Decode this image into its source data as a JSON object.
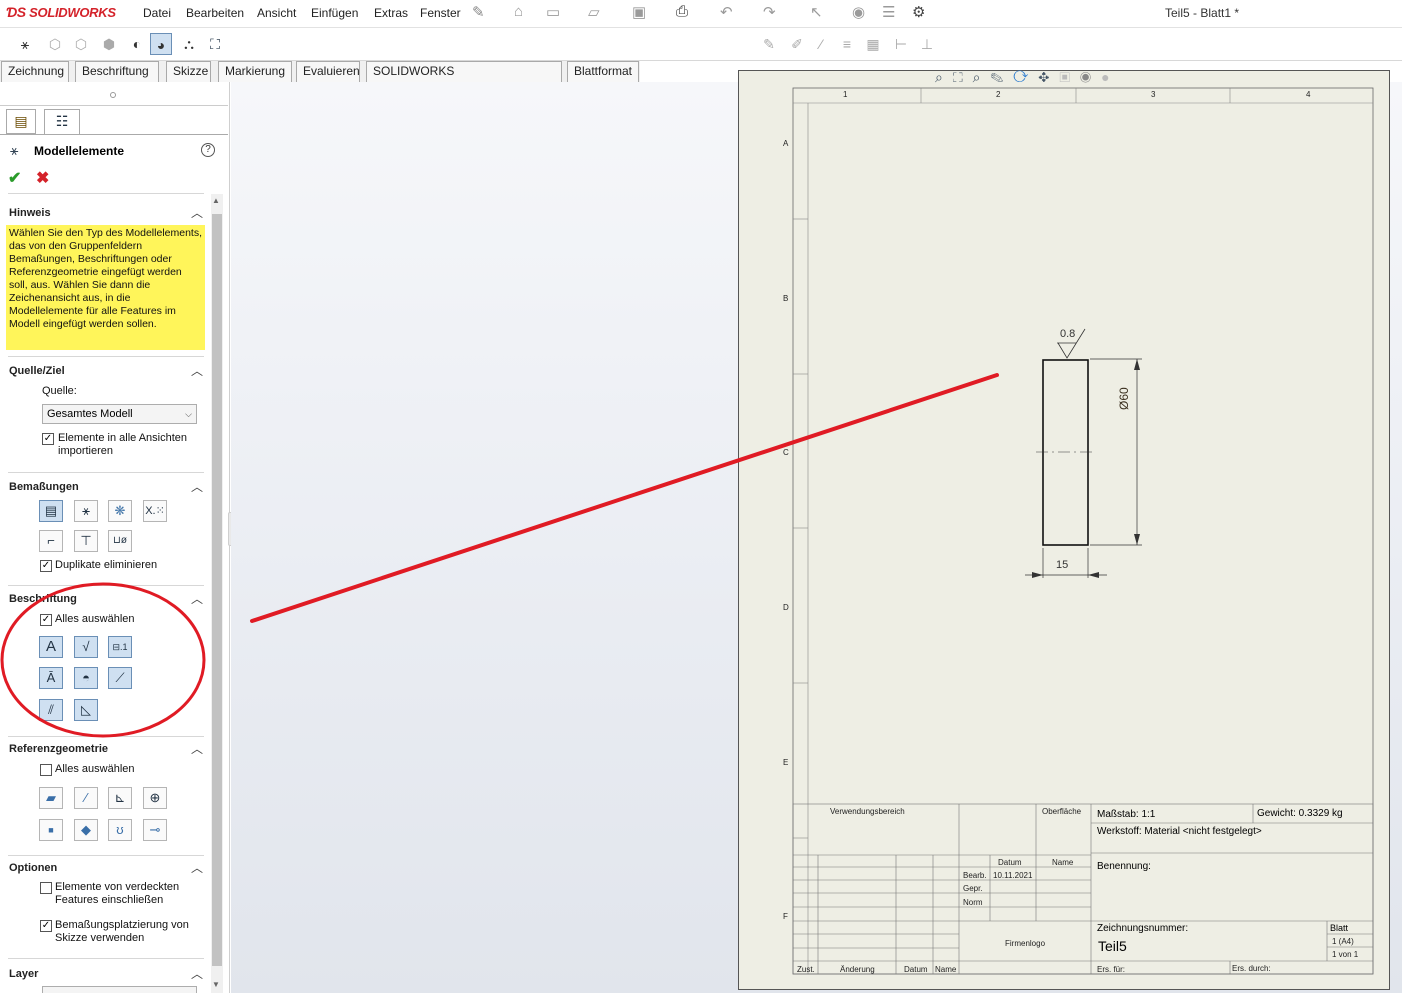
{
  "app": {
    "logo_text": "SOLIDWORKS",
    "document_title": "Teil5 - Blatt1 *"
  },
  "menu": [
    "Datei",
    "Bearbeiten",
    "Ansicht",
    "Einfügen",
    "Extras",
    "Fenster"
  ],
  "tabs": [
    "Zeichnung",
    "Beschriftung",
    "Skizze",
    "Markierung",
    "Evaluieren",
    "SOLIDWORKS Zusatzanwendungen",
    "Blattformat"
  ],
  "panel": {
    "title": "Modellelemente",
    "sections": {
      "hinweis": {
        "title": "Hinweis",
        "text": "Wählen Sie den Typ des Modellelements, das von den Gruppenfeldern Bemaßungen, Beschriftungen oder Referenzgeometrie eingefügt werden soll, aus. Wählen Sie dann die Zeichenansicht aus, in die Modellelemente für alle Features im Modell eingefügt werden sollen."
      },
      "quelle": {
        "title": "Quelle/Ziel",
        "source_label": "Quelle:",
        "source_value": "Gesamtes Modell",
        "import_all_label": "Elemente in alle Ansichten importieren",
        "import_all_checked": true
      },
      "bemassungen": {
        "title": "Bemaßungen",
        "duplicates_label": "Duplikate eliminieren",
        "duplicates_checked": true
      },
      "beschriftung": {
        "title": "Beschriftung",
        "select_all_label": "Alles auswählen",
        "select_all_checked": true
      },
      "referenz": {
        "title": "Referenzgeometrie",
        "select_all_label": "Alles auswählen",
        "select_all_checked": false
      },
      "optionen": {
        "title": "Optionen",
        "hidden_label": "Elemente von verdeckten Features einschließen",
        "hidden_checked": false,
        "sketch_label": "Bemaßungsplatzierung von Skizze verwenden",
        "sketch_checked": true
      },
      "layer": {
        "title": "Layer"
      }
    }
  },
  "drawing": {
    "columns": [
      "1",
      "2",
      "3",
      "4"
    ],
    "rows": [
      "A",
      "B",
      "C",
      "D",
      "E",
      "F"
    ],
    "surface_symbol": "0.8",
    "diameter_dim": "Ø60",
    "width_dim": "15",
    "title_block": {
      "verwendung": "Verwendungsbereich",
      "oberflaeche": "Oberfläche",
      "massstab": "Maßstab: 1:1",
      "gewicht": "Gewicht: 0.3329 kg",
      "werkstoff": "Werkstoff: Material <nicht festgelegt>",
      "datum_h": "Datum",
      "name_h": "Name",
      "bearb": "Bearb.",
      "bearb_date": "10.11.2021",
      "gepr": "Gepr.",
      "norm": "Norm",
      "benennung": "Benennung:",
      "firmenlogo": "Firmenlogo",
      "zeichnungsnummer": "Zeichnungsnummer:",
      "teil": "Teil5",
      "blatt": "Blatt",
      "blatt_a4": "1 (A4)",
      "blatt_von": "1 von 1",
      "zust": "Zust.",
      "aenderung": "Änderung",
      "datum": "Datum",
      "name": "Name",
      "ers_fuer": "Ers. für:",
      "ers_durch": "Ers. durch:"
    }
  },
  "colors": {
    "accent_red": "#d4222a",
    "hint_yellow": "#fff55a",
    "sheet_bg": "#eeeee4"
  }
}
